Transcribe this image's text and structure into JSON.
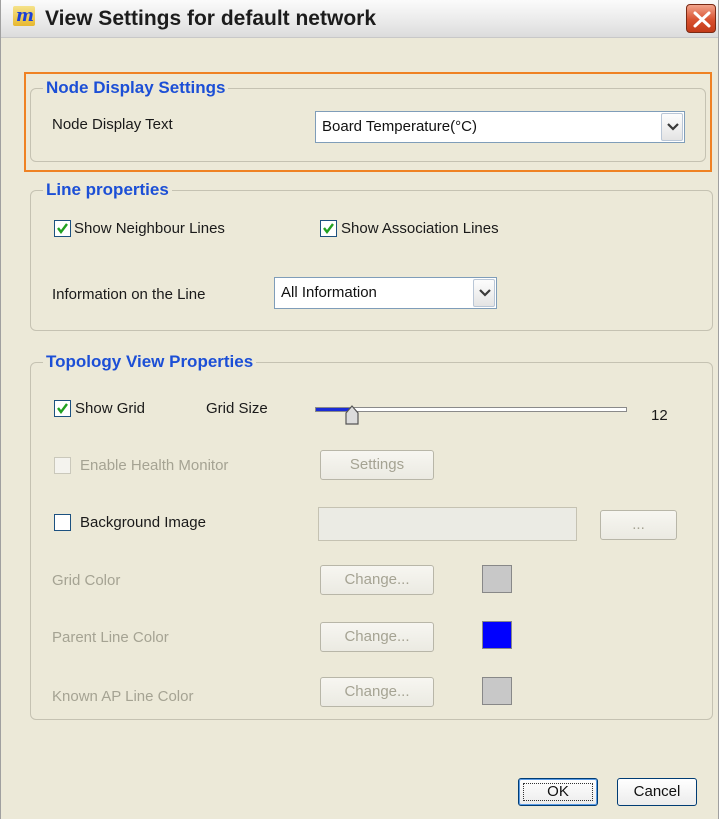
{
  "window": {
    "title": "View Settings for default network",
    "app_icon_text": "m"
  },
  "node_display": {
    "legend": "Node Display Settings",
    "label": "Node Display Text",
    "value": "Board Temperature(°C)"
  },
  "line_properties": {
    "legend": "Line properties",
    "show_neighbour_lines": {
      "label": "Show Neighbour Lines",
      "checked": true
    },
    "show_association_lines": {
      "label": "Show Association Lines",
      "checked": true
    },
    "info_label": "Information on the Line",
    "info_value": "All Information"
  },
  "topology": {
    "legend": "Topology View Properties",
    "show_grid": {
      "label": "Show Grid",
      "checked": true
    },
    "grid_size_label": "Grid Size",
    "grid_size_value": "12",
    "grid_size_fraction": 0.12,
    "enable_health": {
      "label": "Enable Health Monitor",
      "checked": false
    },
    "settings_button": "Settings",
    "background_image": {
      "label": "Background Image",
      "checked": false
    },
    "browse_button": "...",
    "grid_color": {
      "label": "Grid Color",
      "button": "Change...",
      "color": "#c8c8c8"
    },
    "parent_line_color": {
      "label": "Parent Line Color",
      "button": "Change...",
      "color": "#0000ff"
    },
    "known_ap_line_color": {
      "label": "Known AP Line Color",
      "button": "Change...",
      "color": "#c8c8c8"
    }
  },
  "footer": {
    "ok": "OK",
    "cancel": "Cancel"
  }
}
